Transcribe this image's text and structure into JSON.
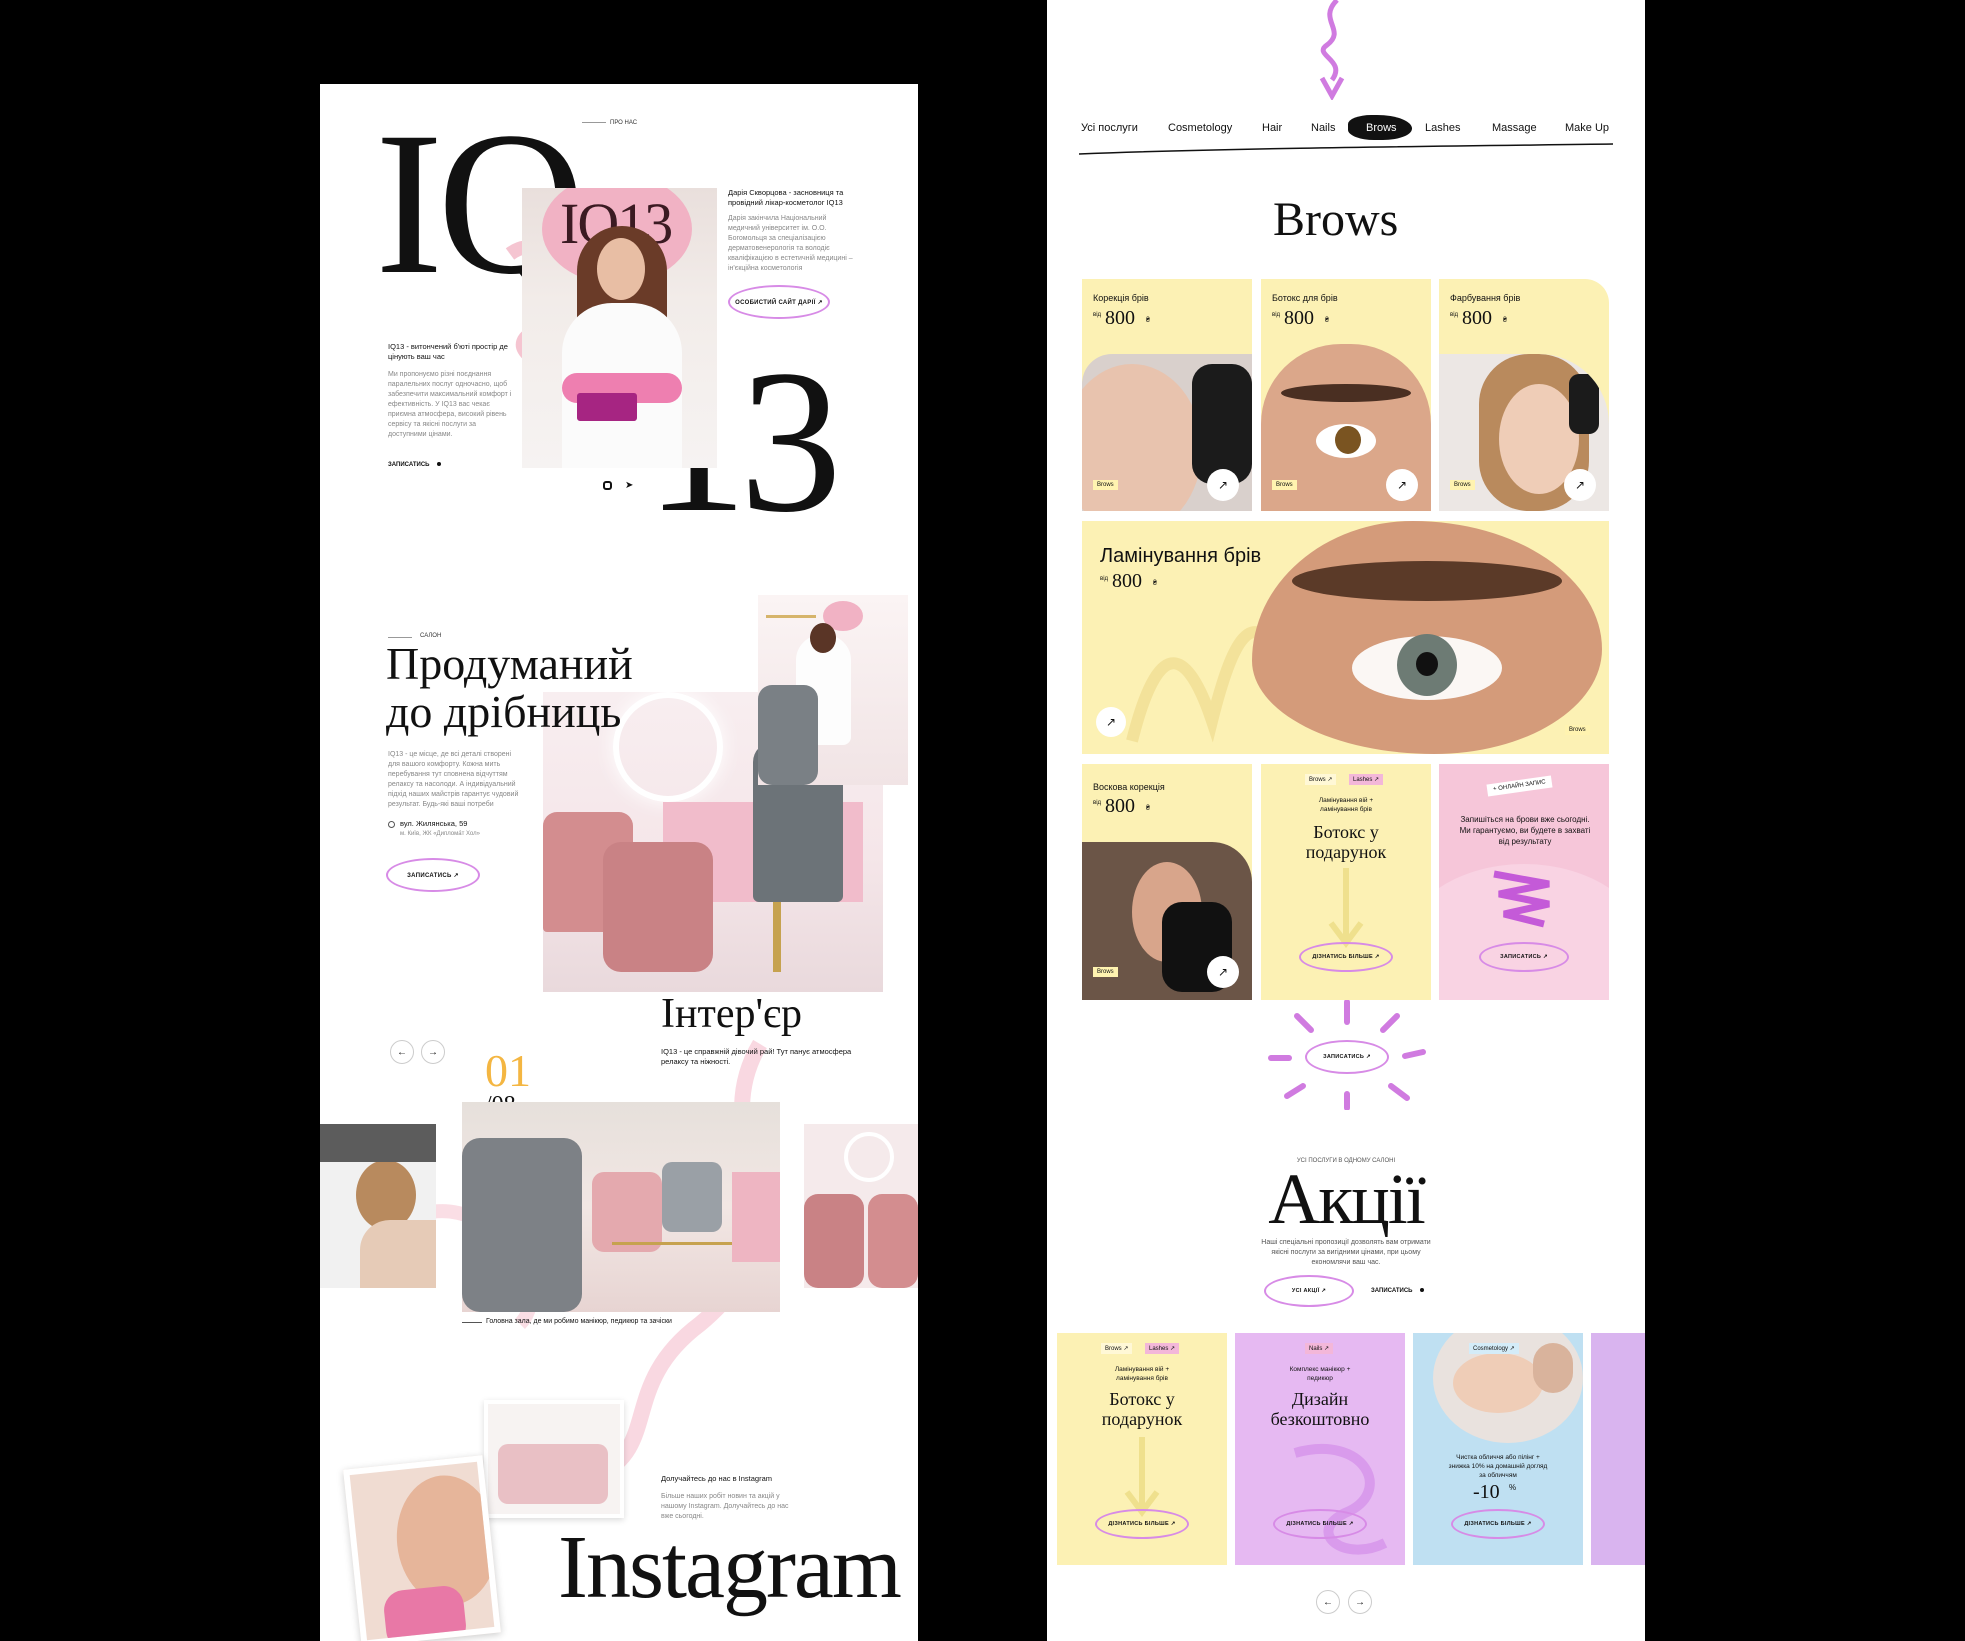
{
  "colors": {
    "pink": "#f3b7c6",
    "yellow": "#fcf1b4",
    "lilac": "#e6b9f2",
    "purple": "#d07be0",
    "blue": "#bfe0f2",
    "accent": "#f4b642"
  },
  "left": {
    "about_label": "ПРО НАС",
    "big_iq": "IQ",
    "big_13": "13",
    "logo_text": "IQ13",
    "founder_title": "Дарія Скворцова - засновниця та провідний лікар-косметолог IQ13",
    "founder_text": "Дарія закінчила Національний медичний університет ім. О.О. Богомольця за спеціалізацією дерматовенерологія та володіє кваліфікацією в естетичній медицині – ін'єкційна косметологія",
    "founder_btn": "ОСОБИСТИЙ САЙТ ДАРІЇ ↗",
    "intro_title": "IQ13 - витончений б'юті простір де цінують ваш час",
    "intro_text": "Ми пропонуємо різні поєднання паралельних послуг одночасно, щоб забезпечити максимальний комфорт і ефективність. У IQ13 вас чекає приємна атмосфера, високий рівень сервісу та якісні послуги за доступними цінами.",
    "intro_link": "ЗАПИСАТИСЬ",
    "salon_label": "САЛОН",
    "salon_title_1": "Продуманий",
    "salon_title_2": "до дрібниць",
    "salon_text": "IQ13 - це місце, де всі деталі створені для вашого комфорту. Кожна мить перебування тут сповнена відчуттям релаксу та насолоди. А індивідуальний підхід наших майстрів гарантує чудовий результат. Будь-які ваші потреби",
    "salon_addr": "вул. Жилянська, 59",
    "salon_addr2": "м. Київ, ЖК «Диплома́т Хол»",
    "salon_btn": "ЗАПИСАТИСЬ ↗",
    "interior_title": "Інтер'єр",
    "interior_text": "IQ13 - це справжній дівочий рай! Тут панує атмосфера релаксу та ніжності.",
    "counter_current": "01",
    "counter_total": "/08",
    "interior_caption": "Головна зала, де ми робимо манікюр, педикюр та зачіски",
    "insta_title": "Долучайтесь до нас в Instagram",
    "insta_text": "Більше наших робіт новин та акцій у нашому Instagram. Долучайтесь до нас вже сьогодні.",
    "insta_big": "Instagram"
  },
  "right": {
    "tabs": [
      "Усі послуги",
      "Cosmetology",
      "Hair",
      "Nails",
      "Brows",
      "Lashes",
      "Massage",
      "Make Up"
    ],
    "active_tab": "Brows",
    "section_title": "Brows",
    "from": "від",
    "cards": [
      {
        "title": "Корекція брів",
        "price": "800",
        "currency": "₴",
        "tag": "Brows"
      },
      {
        "title": "Ботокс для брів",
        "price": "800",
        "currency": "₴",
        "tag": "Brows"
      },
      {
        "title": "Фарбування брів",
        "price": "800",
        "currency": "₴",
        "tag": "Brows"
      }
    ],
    "wide_card": {
      "title": "Ламінування брів",
      "price": "800",
      "currency": "₴",
      "tag": "Brows"
    },
    "wax_card": {
      "title": "Воскова корекція",
      "price": "800",
      "currency": "₴",
      "tag": "Brows"
    },
    "gift_card": {
      "tag1": "Brows ↗",
      "tag2": "Lashes ↗",
      "sub": "Ламінування вій + ламінування брів",
      "title_1": "Ботокс у",
      "title_2": "подарунок",
      "btn": "ДІЗНАТИСЬ БІЛЬШЕ ↗"
    },
    "online_card": {
      "badge": "+ ОНЛАЙН ЗАПИС",
      "text": "Запишіться на брови вже сьогодні. Ми гарантуємо, ви будете в захваті від результату",
      "btn": "ЗАПИСАТИСЬ ↗"
    },
    "sun_btn": "ЗАПИСАТИСЬ ↗",
    "promo_label": "УСІ ПОСЛУГИ В ОДНОМУ САЛОНІ",
    "promo_title": "Акції",
    "promo_text": "Наші спеціальні пропозиції дозволять вам отримати якісні послуги за вигідними цінами, при цьому економлячи ваш час.",
    "promo_btn_all": "УСІ АКЦІЇ ↗",
    "promo_btn_book": "ЗАПИСАТИСЬ",
    "promos": [
      {
        "tags": [
          "Brows ↗",
          "Lashes ↗"
        ],
        "sub": "Ламінування вій + ламінування брів",
        "title_1": "Ботокс у",
        "title_2": "подарунок",
        "btn": "ДІЗНАТИСЬ БІЛЬШЕ ↗"
      },
      {
        "tags": [
          "Nails ↗"
        ],
        "sub": "Комплекс манікюр + педикюр",
        "title_1": "Дизайн",
        "title_2": "безкоштовно",
        "btn": "ДІЗНАТИСЬ БІЛЬШЕ ↗"
      },
      {
        "tags": [
          "Cosmetology ↗"
        ],
        "sub": "Чистка обличчя або пілінг + знижка 10% на домашній догляд за обличчям",
        "title_1": "-10",
        "title_2": "%",
        "btn": "ДІЗНАТИСЬ БІЛЬШЕ ↗"
      }
    ]
  }
}
